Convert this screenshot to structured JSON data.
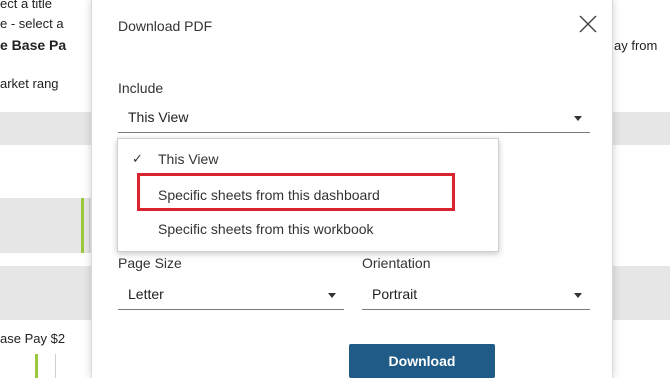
{
  "background": {
    "line1": "ect a title",
    "line2": "e - select a",
    "line3": "e Base Pa",
    "line4": "arket rang",
    "line5": "ase Pay $2",
    "right_text": "ay from"
  },
  "dialog": {
    "title": "Download PDF",
    "include_label": "Include",
    "include_value": "This View",
    "page_size_label": "Page Size",
    "page_size_value": "Letter",
    "orientation_label": "Orientation",
    "orientation_value": "Portrait",
    "download_label": "Download"
  },
  "dropdown": {
    "items": [
      {
        "label": "This View",
        "check": "✓"
      },
      {
        "label": "Specific sheets from this dashboard"
      },
      {
        "label": "Specific sheets from this workbook"
      }
    ]
  },
  "colors": {
    "accent": "#1f5b86",
    "highlight": "#d9232d"
  }
}
